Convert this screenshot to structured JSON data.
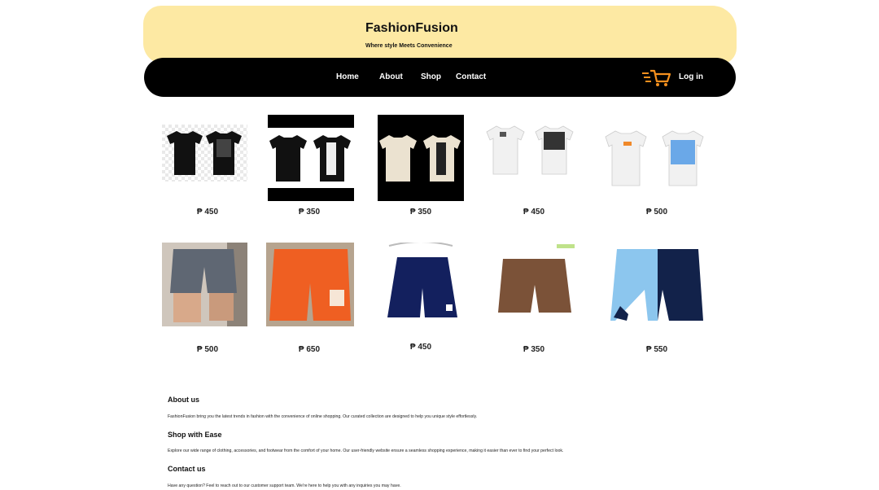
{
  "header": {
    "brand": "FashionFusion",
    "tagline": "Where style Meets Convenience",
    "bg_color": "#fde9a3"
  },
  "nav": {
    "items": [
      {
        "label": "Home"
      },
      {
        "label": "About"
      },
      {
        "label": "Shop"
      },
      {
        "label": "Contact"
      }
    ],
    "cart_icon": "shopping-cart-icon",
    "login_label": "Log in",
    "accent": "#f5901e"
  },
  "products": {
    "row1": [
      {
        "price": "₱ 450",
        "item": "black tshirt pair"
      },
      {
        "price": "₱ 350",
        "item": "black tshirt love"
      },
      {
        "price": "₱ 350",
        "item": "cream tshirt love"
      },
      {
        "price": "₱ 450",
        "item": "white tshirt print"
      },
      {
        "price": "₱ 500",
        "item": "white tshirt blue print"
      }
    ],
    "row2": [
      {
        "price": "₱ 500",
        "item": "grey shorts"
      },
      {
        "price": "₱ 650",
        "item": "orange shorts"
      },
      {
        "price": "₱ 450",
        "item": "navy shorts"
      },
      {
        "price": "₱ 350",
        "item": "brown shorts"
      },
      {
        "price": "₱ 550",
        "item": "blue navy shorts"
      }
    ]
  },
  "info": {
    "about_title": "About us",
    "about_text": "FashionFusion bring you the latest trends in fashion with the convenience of online shopping. Our curated collection are designed to help you unique style effortlessly.",
    "shop_title": "Shop with Ease",
    "shop_text": "Explore our wide range of clothing, accessories, and footwear from the comfort of your home. Our  user-friendly website ensure a seamless shopping experience, making it easier than ever to find your perfect look.",
    "contact_title": "Contact us",
    "contact_text": "Have any question? Feel to reach out to our customer support team. We're here to help you with any inquiries you may have."
  }
}
